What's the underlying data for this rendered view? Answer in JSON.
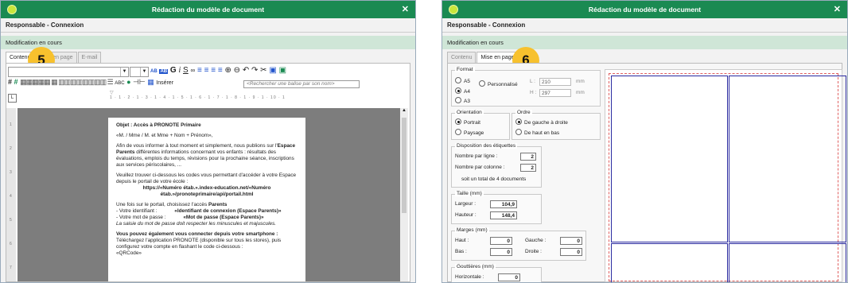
{
  "window1": {
    "title": "Rédaction du modèle de document",
    "subtitle": "Responsable - Connexion",
    "status": "Modification en cours",
    "tabs": [
      "Contenu",
      "Mise en page",
      "E-mail"
    ],
    "step_badge": "5",
    "toolbar": {
      "insert_label": "Insérer",
      "search_placeholder": "<Rechercher une balise par son nom>",
      "bold": "G",
      "italic": "I",
      "underline": "S"
    },
    "ruler_text": "1 · 1 · 2 · 1 · 3 · 1 · 4 · 1 · 5 · 1 · 6 · 1 · 7 · 1 · 8 · 1 · 9 · 1 · 10 · 1",
    "vruler": [
      "1",
      "2",
      "3",
      "4",
      "5",
      "6",
      "7"
    ],
    "document": {
      "heading": "Objet : Accès à PRONOTE Primaire",
      "salutation": "«M. / Mme / M. et Mme + Nom + Prénom»,",
      "p1_pre": "Afin de vous informer à tout moment et simplement, nous publions sur l'",
      "p1_bold": "Espace Parents",
      "p1_post": " différentes informations concernant vos enfants : résultats des évaluations, emplois du temps, révisions pour la prochaine séance, inscriptions aux services périscolaires, ...",
      "p2": "Veuillez trouver ci-dessous les codes vous permettant d'accéder à votre Espace depuis le portail de votre école :",
      "url": "https://«Numéro étab.».index-education.net/«Numéro étab.»/pronoteprimaire/api/portail.html",
      "p3_pre": "Une fois sur le portail, choisissez l'accès ",
      "p3_bold": "Parents",
      "id_label": "- Votre identifiant :",
      "id_value": "«Identifiant de connexion (Espace Parents)»",
      "pw_label": "- Votre mot de passe :",
      "pw_value": "«Mot de passe (Espace Parents)»",
      "note": "La saisie du mot de passe doit respecter les minuscules et majuscules.",
      "p4_bold": "Vous pouvez également vous connecter depuis votre smartphone :",
      "p4": "Téléchargez l'application PRONOTE (disponible sur tous les stores), puis configurez votre compte en flashant le code ci-dessous :",
      "qr": "«QRCode»"
    }
  },
  "window2": {
    "title": "Rédaction du modèle de document",
    "subtitle": "Responsable - Connexion",
    "status": "Modification en cours",
    "tabs": [
      "Contenu",
      "Mise en page"
    ],
    "step_badge": "6",
    "format": {
      "legend": "Format",
      "options": [
        "A5",
        "A4",
        "A3"
      ],
      "selected": "A4",
      "custom_label": "Personnalisé",
      "l_label": "L :",
      "l_value": "210",
      "h_label": "H :",
      "h_value": "297",
      "unit": "mm"
    },
    "orientation": {
      "legend": "Orientation",
      "options": [
        "Portrait",
        "Paysage"
      ],
      "selected": "Portrait"
    },
    "ordre": {
      "legend": "Ordre",
      "options": [
        "De gauche à droite",
        "De haut en bas"
      ],
      "selected": "De gauche à droite"
    },
    "disposition": {
      "legend": "Disposition des étiquettes",
      "per_row_label": "Nombre par ligne :",
      "per_row": "2",
      "per_col_label": "Nombre par colonne :",
      "per_col": "2",
      "total": "soit un total de 4 documents"
    },
    "taille": {
      "legend": "Taille (mm)",
      "w_label": "Largeur :",
      "w": "104,9",
      "h_label": "Hauteur :",
      "h": "148,4"
    },
    "marges": {
      "legend": "Marges (mm)",
      "haut_label": "Haut :",
      "haut": "0",
      "bas_label": "Bas :",
      "bas": "0",
      "gauche_label": "Gauche :",
      "gauche": "0",
      "droite_label": "Droite :",
      "droite": "0"
    },
    "gouttieres": {
      "legend": "Gouttières (mm)",
      "h_label": "Horizontale :",
      "h": "0"
    }
  },
  "colors": {
    "titlebar": "#1a8a52",
    "status": "#cfe6d7",
    "badge": "#f7c12e",
    "grid": "#2a2aa0"
  }
}
